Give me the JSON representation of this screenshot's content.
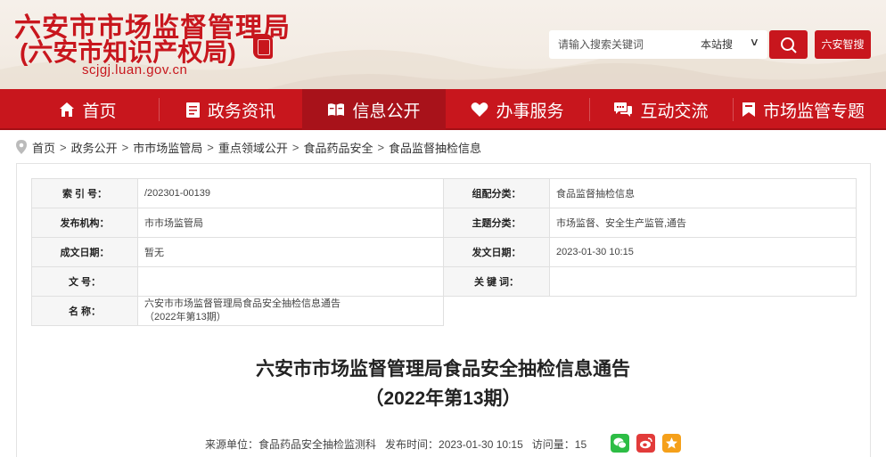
{
  "header": {
    "title_line1": "六安市市场监督管理局",
    "title_line2": "(六安市知识产权局)",
    "site_url": "scjgj.luan.gov.cn",
    "search_placeholder": "请输入搜索关键词",
    "search_scope": "本站搜",
    "smart_search_label": "六安智搜"
  },
  "nav": {
    "items": [
      {
        "label": "首页",
        "icon": "home-icon"
      },
      {
        "label": "政务资讯",
        "icon": "document-icon"
      },
      {
        "label": "信息公开",
        "icon": "open-book-icon"
      },
      {
        "label": "办事服务",
        "icon": "heart-icon"
      },
      {
        "label": "互动交流",
        "icon": "chat-icon"
      },
      {
        "label": "市场监管专题",
        "icon": "bookmark-icon"
      }
    ],
    "active_index": 2
  },
  "breadcrumb": [
    "首页",
    "政务公开",
    "市市场监管局",
    "重点领域公开",
    "食品药品安全",
    "食品监督抽检信息"
  ],
  "meta": {
    "index_label": "索 引 号：",
    "index_value": "/202301-00139",
    "org_category_label": "组配分类：",
    "org_category_value": "食品监督抽检信息",
    "publisher_label": "发布机构：",
    "publisher_value": "市市场监管局",
    "topic_label": "主题分类：",
    "topic_value": "市场监督、安全生产监管,通告",
    "created_label": "成文日期：",
    "created_value": "暂无",
    "published_label": "发文日期：",
    "published_value": "2023-01-30 10:15",
    "doc_no_label": "文  号：",
    "doc_no_value": "",
    "keywords_label": "关 键 词：",
    "keywords_value": "",
    "name_label": "名  称：",
    "name_value_line1": "六安市市场监督管理局食品安全抽检信息通告",
    "name_value_line2": "（2022年第13期）"
  },
  "article": {
    "title_line1": "六安市市场监督管理局食品安全抽检信息通告",
    "title_line2": "（2022年第13期）",
    "source": "来源单位：食品药品安全抽检监测科",
    "publish_time": "发布时间：2023-01-30 10:15",
    "views": "访问量：15"
  },
  "share": [
    "wechat-icon",
    "weibo-icon",
    "favorite-icon"
  ],
  "colors": {
    "brand_red": "#c8161d",
    "nav_active": "#a8121a"
  }
}
